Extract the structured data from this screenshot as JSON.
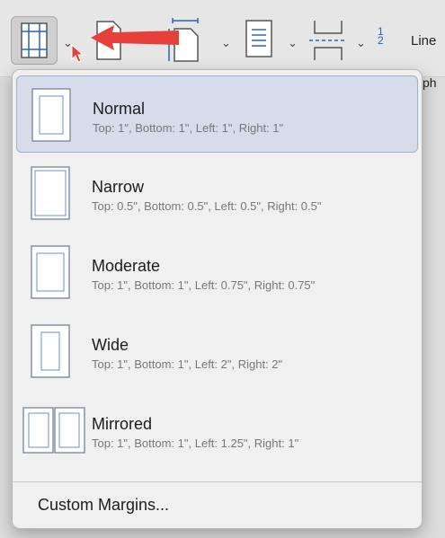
{
  "ribbon": {
    "line_label": "Line",
    "hyphenation_partial": "yph",
    "spacing_glyph_top": "1",
    "spacing_glyph_bottom": "2"
  },
  "menu": {
    "items": [
      {
        "title": "Normal",
        "desc": "Top: 1\", Bottom: 1\", Left: 1\", Right: 1\"",
        "selected": true
      },
      {
        "title": "Narrow",
        "desc": "Top: 0.5\", Bottom: 0.5\", Left: 0.5\", Right: 0.5\"",
        "selected": false
      },
      {
        "title": "Moderate",
        "desc": "Top: 1\", Bottom: 1\", Left: 0.75\", Right: 0.75\"",
        "selected": false
      },
      {
        "title": "Wide",
        "desc": "Top: 1\", Bottom: 1\", Left: 2\", Right: 2\"",
        "selected": false
      },
      {
        "title": "Mirrored",
        "desc": "Top: 1\", Bottom: 1\", Left: 1.25\", Right: 1\"",
        "selected": false
      }
    ],
    "custom_label": "Custom Margins..."
  },
  "colors": {
    "accent_blue": "#2a63b7",
    "selected_bg": "#d6dcea",
    "annotation_arrow": "#e5413a"
  }
}
